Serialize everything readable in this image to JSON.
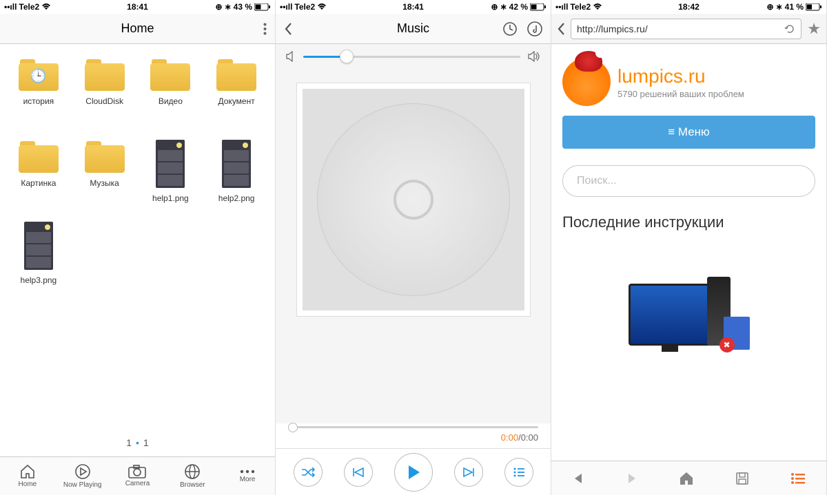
{
  "screens": {
    "files": {
      "status": {
        "carrier": "Tele2",
        "time": "18:41",
        "battery": "43 %",
        "bt": "✻",
        "alarm": "⊙"
      },
      "title": "Home",
      "items": [
        {
          "label": "история",
          "type": "folder",
          "badge": "clock"
        },
        {
          "label": "CloudDisk",
          "type": "folder"
        },
        {
          "label": "Видео",
          "type": "folder"
        },
        {
          "label": "Документ",
          "type": "folder"
        },
        {
          "label": "Картинка",
          "type": "folder"
        },
        {
          "label": "Музыка",
          "type": "folder"
        },
        {
          "label": "help1.png",
          "type": "image"
        },
        {
          "label": "help2.png",
          "type": "image"
        },
        {
          "label": "help3.png",
          "type": "image"
        }
      ],
      "page": {
        "current": "1",
        "total": "1"
      },
      "tabs": [
        {
          "label": "Home"
        },
        {
          "label": "Now Playing"
        },
        {
          "label": "Camera"
        },
        {
          "label": "Browser"
        },
        {
          "label": "More"
        }
      ]
    },
    "music": {
      "status": {
        "carrier": "Tele2",
        "time": "18:41",
        "battery": "42 %"
      },
      "title": "Music",
      "volume_percent": 20,
      "progress_percent": 2,
      "time_current": "0:00",
      "time_total": "/0:00"
    },
    "browser": {
      "status": {
        "carrier": "Tele2",
        "time": "18:42",
        "battery": "41 %"
      },
      "url": "http://lumpics.ru/",
      "site_name": "lumpics.ru",
      "site_subtitle": "5790 решений ваших проблем",
      "menu_label": "≡ Меню",
      "search_placeholder": "Поиск...",
      "section_heading": "Последние инструкции"
    }
  }
}
